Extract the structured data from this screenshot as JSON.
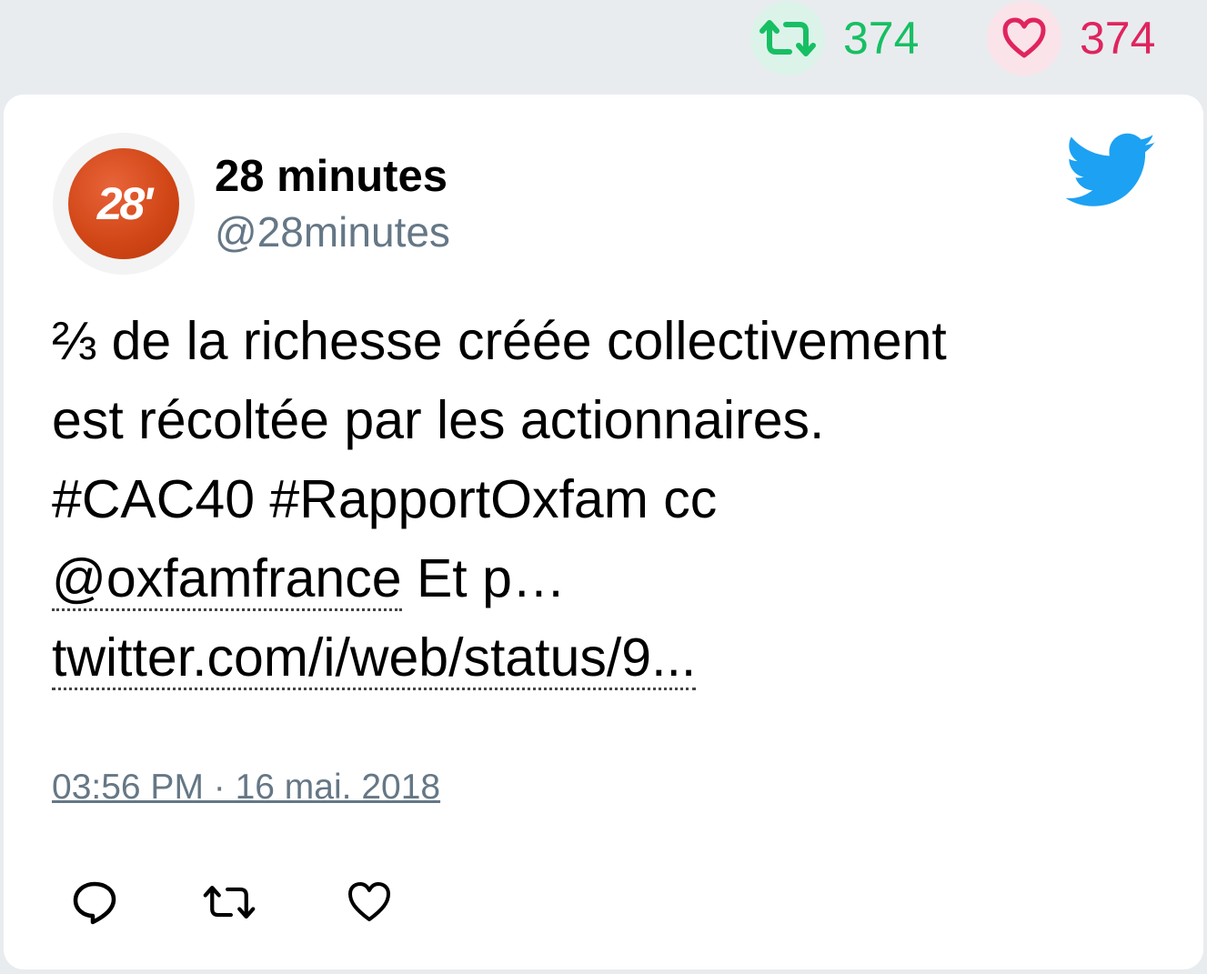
{
  "stats": {
    "retweet_count": "374",
    "like_count": "374"
  },
  "author": {
    "name": "28 minutes",
    "handle": "@28minutes",
    "avatar_text": "28'"
  },
  "tweet": {
    "line1": "⅔ de la richesse créée collectivement",
    "line2": "est récoltée par les actionnaires.",
    "line3": "#CAC40 #RapportOxfam cc",
    "mention": "@oxfamfrance",
    "line4_rest": " Et p…",
    "link": "twitter.com/i/web/status/9..."
  },
  "timestamp": "03:56 PM · 16 mai. 2018",
  "icons": {
    "retweet": "retweet-icon",
    "like": "heart-icon",
    "reply": "reply-icon",
    "brand": "twitter-bird-icon"
  },
  "colors": {
    "retweet_green": "#17bf63",
    "like_red": "#e0245e",
    "twitter_blue": "#1da1f2",
    "muted_gray": "#657786"
  }
}
